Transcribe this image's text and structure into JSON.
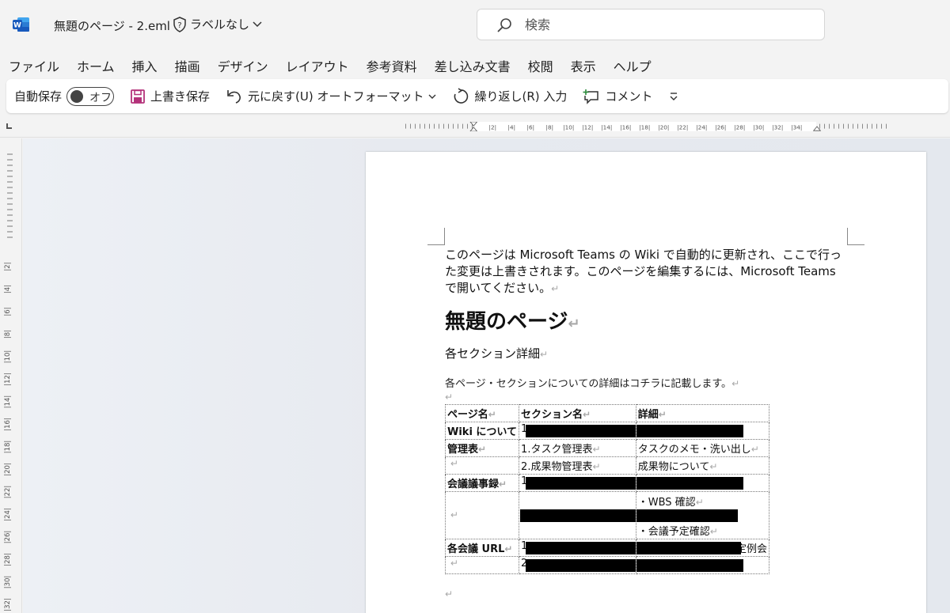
{
  "titlebar": {
    "doc_title": "無題のページ - 2.eml",
    "sensitivity_label": "ラベルなし",
    "search_placeholder": "検索"
  },
  "menu": [
    "ファイル",
    "ホーム",
    "挿入",
    "描画",
    "デザイン",
    "レイアウト",
    "参考資料",
    "差し込み文書",
    "校閲",
    "表示",
    "ヘルプ"
  ],
  "ribbon": {
    "autosave_label": "自動保存",
    "autosave_state": "オフ",
    "save_label": "上書き保存",
    "undo_label": "元に戻す(U) オートフォーマット",
    "redo_label": "繰り返し(R) 入力",
    "comment_label": "コメント"
  },
  "ruler": {
    "horizontal_labels": [
      "2",
      "4",
      "6",
      "8",
      "10",
      "12",
      "14",
      "16",
      "18",
      "20",
      "22",
      "24",
      "26",
      "28",
      "30",
      "32",
      "34"
    ],
    "vertical_labels": [
      "2",
      "4",
      "6",
      "8",
      "10",
      "12",
      "14",
      "16",
      "18",
      "20",
      "22",
      "24",
      "26",
      "28",
      "30",
      "32"
    ]
  },
  "document": {
    "notice": "このページは Microsoft Teams の Wiki で自動的に更新され、ここで行った変更は上書きされます。このページを編集するには、Microsoft Teams で開いてください。",
    "title": "無題のページ",
    "section_heading": "各セクション詳細",
    "description": "各ページ・セクションについての詳細はコチラに記載します。",
    "table": {
      "headers": [
        "ページ名",
        "セクション名",
        "詳細"
      ],
      "rows": [
        {
          "page": "Wiki について",
          "section": "1",
          "detail": ""
        },
        {
          "page": "管理表",
          "section": "1.タスク管理表",
          "detail": "タスクのメモ・洗い出し"
        },
        {
          "page": "",
          "section": "2.成果物管理表",
          "detail": "成果物について"
        },
        {
          "page": "会議議事録",
          "section": "1",
          "detail": ""
        },
        {
          "page": "",
          "section": "",
          "detail_line1": "・WBS 確認",
          "detail_line2": "・会議予定確認"
        },
        {
          "page": "各会議 URL",
          "section": "1",
          "detail": "定例会"
        },
        {
          "page": "",
          "section": "2",
          "detail": ""
        }
      ]
    }
  },
  "colors": {
    "word_blue": "#185abd",
    "save_purple": "#b4327a",
    "redaction": "#000000"
  }
}
